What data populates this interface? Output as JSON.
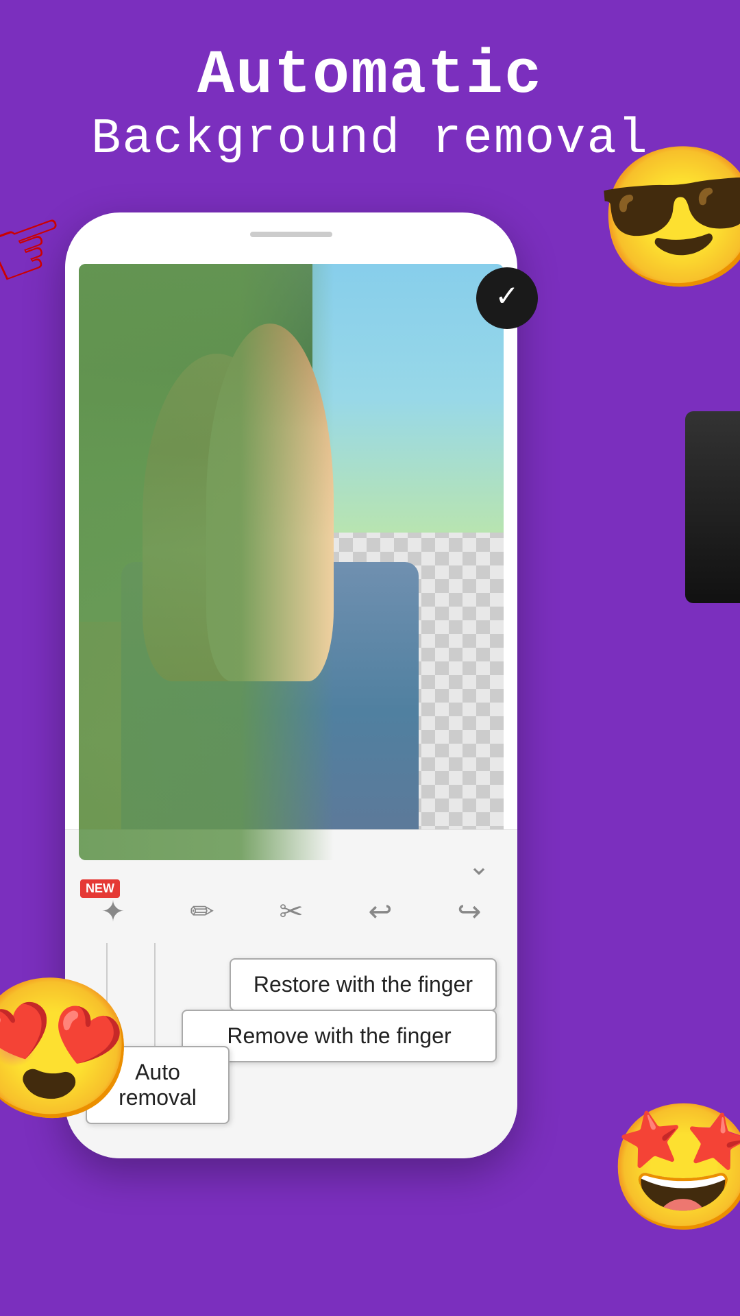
{
  "header": {
    "title": "Automatic",
    "subtitle": "Background removal"
  },
  "check_button": {
    "icon": "✓",
    "label": "Confirm"
  },
  "phone": {
    "image_alt": "Couple on scooter with background removed"
  },
  "toolbar": {
    "chevron": "chevron-down",
    "tools": [
      {
        "id": "auto-wand",
        "icon": "✦",
        "label": "Auto wand",
        "has_new": true
      },
      {
        "id": "brush",
        "icon": "✏",
        "label": "Brush",
        "has_new": false
      },
      {
        "id": "eraser",
        "icon": "✂",
        "label": "Eraser",
        "has_new": false
      },
      {
        "id": "undo",
        "icon": "↩",
        "label": "Undo",
        "has_new": false
      },
      {
        "id": "redo",
        "icon": "↪",
        "label": "Redo",
        "has_new": false
      }
    ],
    "new_badge_label": "NEW",
    "tooltip_restore": "Restore with the finger",
    "tooltip_remove": "Remove with the finger",
    "tooltip_auto": "Auto removal"
  },
  "decorations": {
    "emoji_sunglasses": "😎",
    "emoji_heart_eyes": "😍",
    "emoji_star": "🤩"
  }
}
